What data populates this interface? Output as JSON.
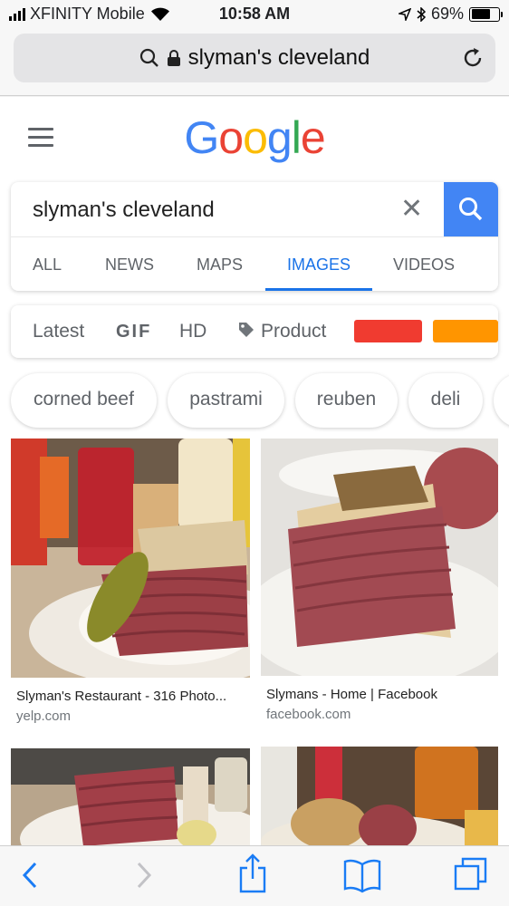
{
  "status_bar": {
    "carrier": "XFINITY Mobile",
    "time": "10:58 AM",
    "battery": "69%",
    "battery_level": 0.69
  },
  "browser": {
    "url_text": "slyman's cleveland"
  },
  "google": {
    "logo": [
      "G",
      "o",
      "o",
      "g",
      "l",
      "e"
    ],
    "logo_colors": [
      "#4285F4",
      "#EA4335",
      "#FBBC05",
      "#4285F4",
      "#34A853",
      "#EA4335"
    ],
    "query": "slyman's cleveland",
    "clear_glyph": "✕",
    "tabs": [
      {
        "label": "ALL"
      },
      {
        "label": "NEWS"
      },
      {
        "label": "MAPS"
      },
      {
        "label": "IMAGES"
      },
      {
        "label": "VIDEOS"
      }
    ],
    "active_tab": "IMAGES",
    "filters": {
      "latest": "Latest",
      "gif": "GIF",
      "hd": "HD",
      "product": "Product",
      "color_swatches": [
        "#F03B30",
        "#FF9500"
      ]
    },
    "chips": [
      {
        "label": "corned beef"
      },
      {
        "label": "pastrami"
      },
      {
        "label": "reuben"
      },
      {
        "label": "deli"
      }
    ],
    "results": [
      {
        "title": "Slyman's Restaurant - 316 Photo...",
        "source": "yelp.com"
      },
      {
        "title": "Slymans - Home | Facebook",
        "source": "facebook.com"
      }
    ]
  },
  "colors": {
    "accent_blue": "#1a73e8",
    "search_button": "#4285f4"
  },
  "toolbar_icons": [
    "back-icon",
    "forward-icon",
    "share-icon",
    "bookmarks-icon",
    "tabs-icon"
  ]
}
